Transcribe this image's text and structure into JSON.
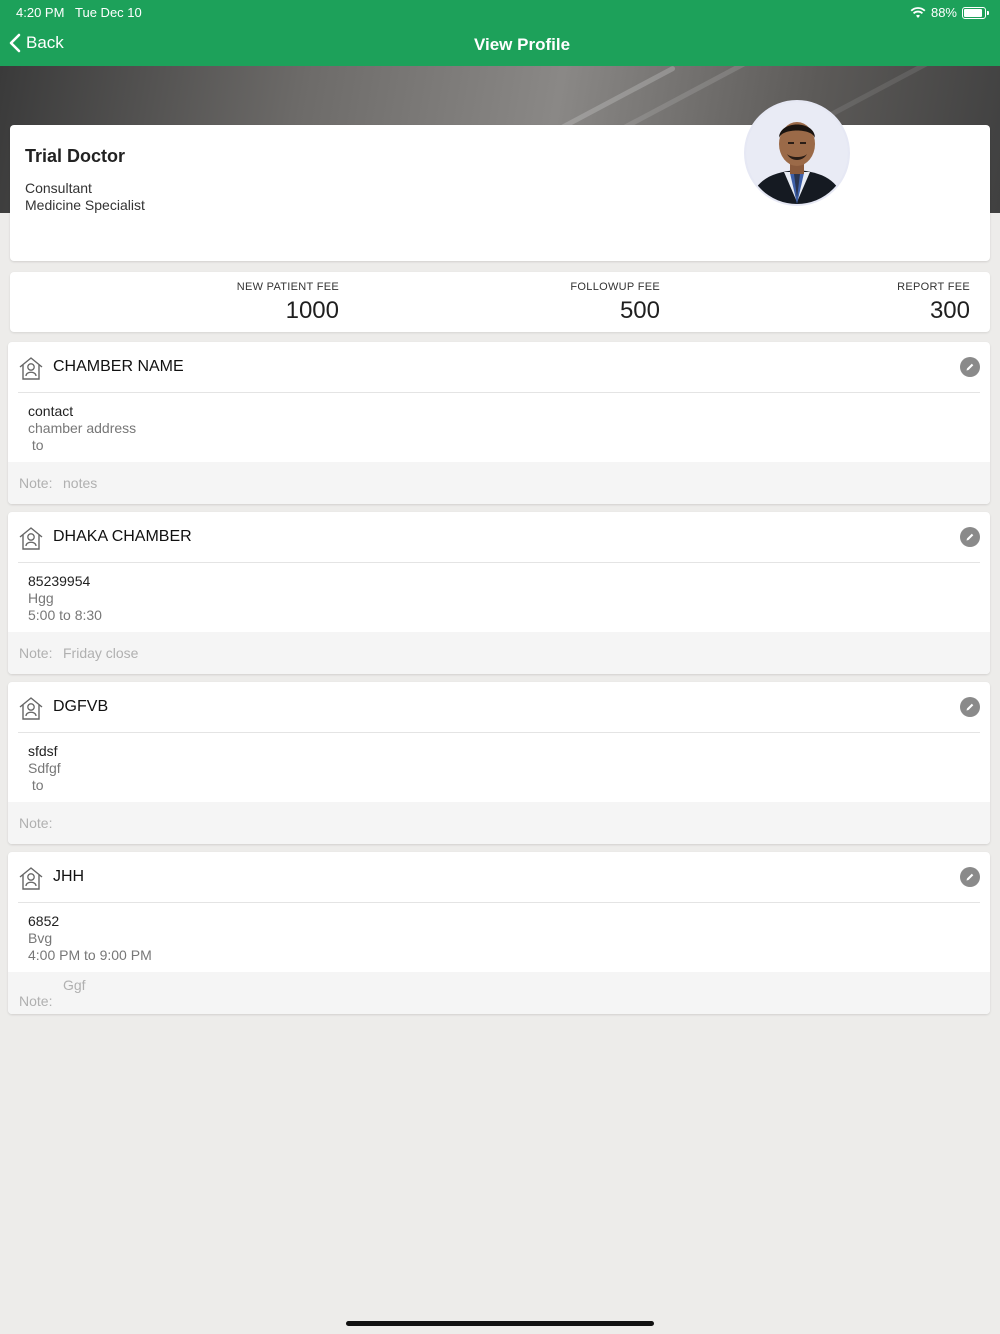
{
  "status": {
    "time": "4:20 PM",
    "date": "Tue Dec 10",
    "battery": "88%",
    "battery_level": 0.88
  },
  "nav": {
    "back_label": "Back",
    "title": "View Profile"
  },
  "profile": {
    "name": "Trial Doctor",
    "designation": "Consultant",
    "specialty": "Medicine Specialist"
  },
  "fees": [
    {
      "label": "NEW PATIENT FEE",
      "value": "1000"
    },
    {
      "label": "FOLLOWUP FEE",
      "value": "500"
    },
    {
      "label": "REPORT FEE",
      "value": "300"
    }
  ],
  "chambers": [
    {
      "name": "CHAMBER NAME",
      "contact": "contact",
      "address": "chamber address",
      "time": " to",
      "note_label": "Note:",
      "note": "notes"
    },
    {
      "name": "DHAKA CHAMBER",
      "contact": "85239954",
      "address": "Hgg",
      "time": "5:00 to 8:30",
      "note_label": "Note:",
      "note": "Friday close"
    },
    {
      "name": "DGFVB",
      "contact": "sfdsf",
      "address": "Sdfgf",
      "time": " to",
      "note_label": "Note:",
      "note": ""
    },
    {
      "name": "JHH",
      "contact": "6852",
      "address": "Bvg",
      "time": "4:00 PM to 9:00 PM",
      "note_label": "Note:",
      "note": "Ggf"
    }
  ],
  "colors": {
    "header": "#1da15a",
    "background": "#edecea"
  }
}
